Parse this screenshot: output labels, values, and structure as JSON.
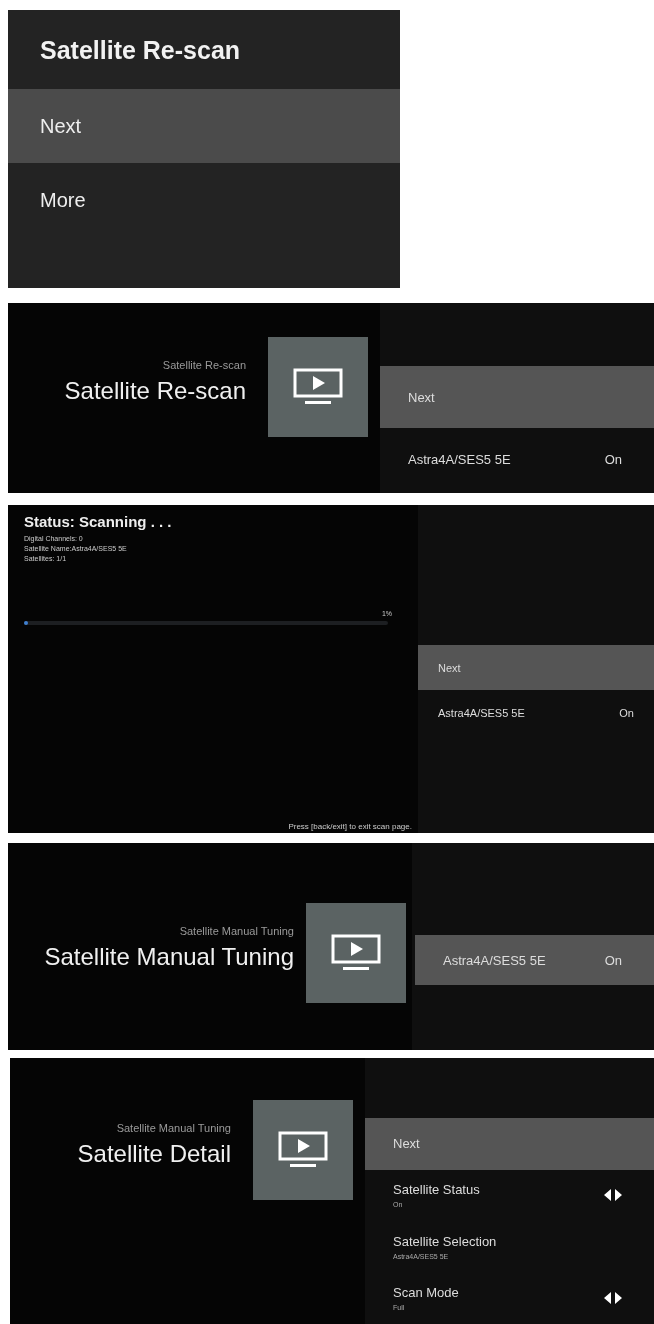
{
  "screens": [
    {
      "kind": "dialog",
      "title": "Satellite Re-scan",
      "items": [
        {
          "label": "Next",
          "selected": true
        },
        {
          "label": "More",
          "selected": false
        }
      ]
    },
    {
      "kind": "menu",
      "breadcrumb": "Satellite Re-scan",
      "title": "Satellite Re-scan",
      "items": [
        {
          "kind": "button",
          "label": "Next",
          "selected": true
        },
        {
          "kind": "value",
          "label": "Astra4A/SES5 5E",
          "value": "On",
          "selected": false
        }
      ]
    },
    {
      "kind": "scan",
      "status": "Status: Scanning . . .",
      "details": [
        "Digital Channels:  0",
        "Satellite Name:Astra4A/SES5 5E",
        "Satellites:  1/1"
      ],
      "percent": "1%",
      "level": 0.01,
      "footer": "Press [back/exit] to exit scan page.",
      "items": [
        {
          "kind": "button",
          "label": "Next",
          "selected": true
        },
        {
          "kind": "value",
          "label": "Astra4A/SES5 5E",
          "value": "On",
          "selected": false
        }
      ]
    },
    {
      "kind": "menu",
      "breadcrumb": "Satellite Manual Tuning",
      "title": "Satellite Manual Tuning",
      "items": [
        {
          "kind": "value",
          "label": "Astra4A/SES5 5E",
          "value": "On",
          "selected": true
        }
      ]
    },
    {
      "kind": "menu",
      "breadcrumb": "Satellite Manual Tuning",
      "title": "Satellite Detail",
      "items": [
        {
          "kind": "button",
          "label": "Next",
          "selected": true
        },
        {
          "kind": "option",
          "label": "Satellite Status",
          "subtitle": "On",
          "arrows": true,
          "selected": false
        },
        {
          "kind": "option",
          "label": "Satellite Selection",
          "subtitle": "Astra4A/SES5 5E",
          "arrows": false,
          "selected": false
        },
        {
          "kind": "option",
          "label": "Scan Mode",
          "subtitle": "Full",
          "arrows": true,
          "selected": false
        }
      ]
    }
  ]
}
